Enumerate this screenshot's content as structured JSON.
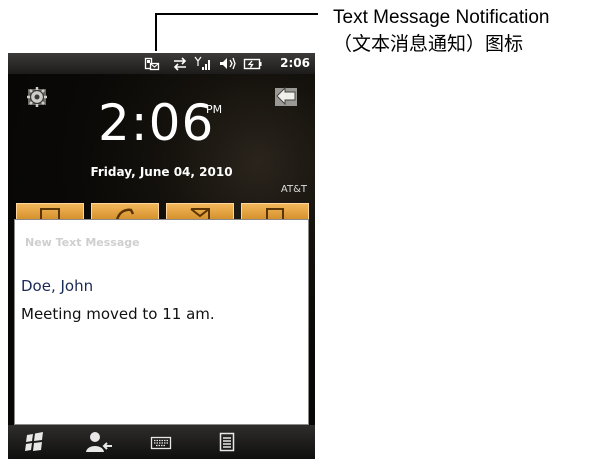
{
  "callout": {
    "line1": "Text Message Notification",
    "line2": "（文本消息通知）图标"
  },
  "statusbar": {
    "icons": [
      "text-message-notification-icon",
      "data-connection-icon",
      "signal-strength-icon",
      "volume-icon",
      "battery-icon"
    ],
    "time": "2:06"
  },
  "home": {
    "time": "2:06",
    "ampm": "PM",
    "date": "Friday, June 04, 2010",
    "carrier": "AT&T",
    "tiles": [
      "messaging-tile",
      "phone-tile",
      "email-tile",
      "calendar-tile"
    ]
  },
  "popup": {
    "title": "New Text Message",
    "sender": "Doe, John",
    "message": "Meeting moved to 11 am."
  },
  "taskbar": {
    "buttons": [
      "start-button",
      "contacts-button",
      "keyboard-button",
      "menu-button"
    ]
  },
  "colors": {
    "accent_tile": "#e9a443",
    "background": "#090806",
    "popup_bg": "#ffffff"
  }
}
